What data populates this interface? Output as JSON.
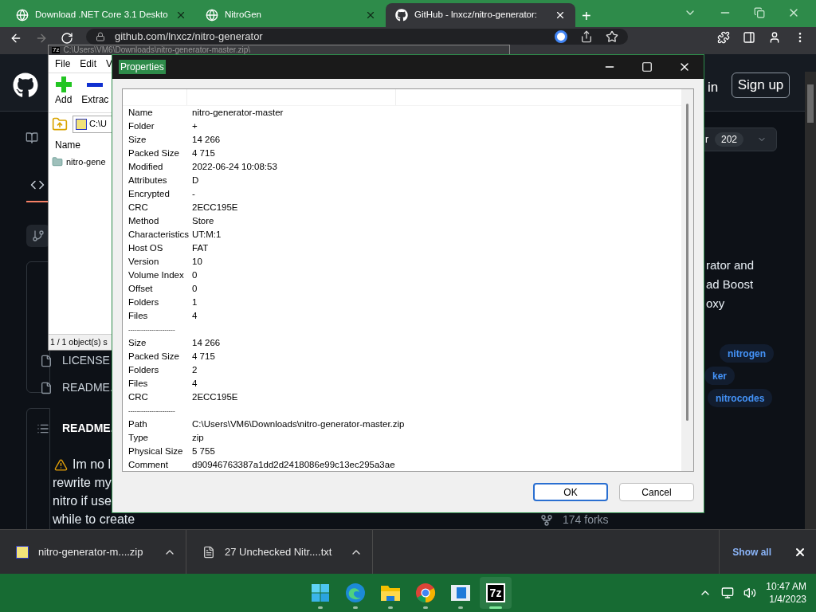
{
  "browser": {
    "tabs": [
      {
        "title": "Download .NET Core 3.1 Deskto",
        "selected": false
      },
      {
        "title": "NitroGen",
        "selected": false
      },
      {
        "title": "GitHub - lnxcz/nitro-generator:",
        "selected": true
      }
    ],
    "new_tab": "+",
    "address": "github.com/lnxcz/nitro-generator"
  },
  "github": {
    "sign_in": "in",
    "sign_up": "Sign up",
    "star_label": "r",
    "star_count": "202",
    "about_lines": [
      "rator and",
      "ad Boost",
      "oxy"
    ],
    "topics": [
      "nitrogen",
      "ker",
      "nitrocodes"
    ],
    "files": [
      "LICENSE",
      "README."
    ],
    "readme_title": "README.",
    "readme_lines": [
      "Im no l",
      "rewrite my",
      "nitro if use",
      "while to create"
    ],
    "forks": "174 forks"
  },
  "archive_window": {
    "icon_label": "7z",
    "title": "C:\\Users\\VM6\\Downloads\\nitro-generator-master.zip\\",
    "menu": [
      "File",
      "Edit",
      "V"
    ],
    "tools": [
      {
        "label": "Add",
        "kind": "add"
      },
      {
        "label": "Extrac",
        "kind": "extract"
      }
    ],
    "path": "C:\\U",
    "column": "Name",
    "items": [
      "nitro-gene"
    ],
    "status": "1 / 1 object(s) s"
  },
  "properties": {
    "title": "Properties",
    "rows": [
      {
        "kind": "pair",
        "name": "Name",
        "value": "nitro-generator-master"
      },
      {
        "kind": "pair",
        "name": "Folder",
        "value": "+"
      },
      {
        "kind": "pair",
        "name": "Size",
        "value": "14 266"
      },
      {
        "kind": "pair",
        "name": "Packed Size",
        "value": "4 715"
      },
      {
        "kind": "pair",
        "name": "Modified",
        "value": "2022-06-24 10:08:53"
      },
      {
        "kind": "pair",
        "name": "Attributes",
        "value": "D"
      },
      {
        "kind": "pair",
        "name": "Encrypted",
        "value": "-"
      },
      {
        "kind": "pair",
        "name": "CRC",
        "value": "2ECC195E"
      },
      {
        "kind": "pair",
        "name": "Method",
        "value": "Store"
      },
      {
        "kind": "pair",
        "name": "Characteristics",
        "value": "UT:M:1"
      },
      {
        "kind": "pair",
        "name": "Host OS",
        "value": "FAT"
      },
      {
        "kind": "pair",
        "name": "Version",
        "value": "10"
      },
      {
        "kind": "pair",
        "name": "Volume Index",
        "value": "0"
      },
      {
        "kind": "pair",
        "name": "Offset",
        "value": "0"
      },
      {
        "kind": "pair",
        "name": "Folders",
        "value": "1"
      },
      {
        "kind": "pair",
        "name": "Files",
        "value": "4"
      },
      {
        "kind": "separator",
        "name": "----------------------"
      },
      {
        "kind": "pair",
        "name": "Size",
        "value": "14 266"
      },
      {
        "kind": "pair",
        "name": "Packed Size",
        "value": "4 715"
      },
      {
        "kind": "pair",
        "name": "Folders",
        "value": "2"
      },
      {
        "kind": "pair",
        "name": "Files",
        "value": "4"
      },
      {
        "kind": "pair",
        "name": "CRC",
        "value": "2ECC195E"
      },
      {
        "kind": "separator",
        "name": "----------------------"
      },
      {
        "kind": "pair",
        "name": "Path",
        "value": "C:\\Users\\VM6\\Downloads\\nitro-generator-master.zip"
      },
      {
        "kind": "pair",
        "name": "Type",
        "value": "zip"
      },
      {
        "kind": "pair",
        "name": "Physical Size",
        "value": "5 755"
      },
      {
        "kind": "pair",
        "name": "Comment",
        "value": "d90946763387a1dd2d2418086e99c13ec295a3ae"
      }
    ],
    "buttons": [
      {
        "label": "OK",
        "default": true
      },
      {
        "label": "Cancel",
        "default": false
      }
    ]
  },
  "downloads": {
    "items": [
      {
        "name": "nitro-generator-m....zip",
        "kind": "archive"
      },
      {
        "name": "27 Unchecked Nitr....txt",
        "kind": "text"
      }
    ],
    "show_all": "Show all"
  },
  "taskbar": {
    "apps": [
      {
        "kind": "start",
        "active": false
      },
      {
        "kind": "edge",
        "active": false
      },
      {
        "kind": "explorer",
        "active": false
      },
      {
        "kind": "chrome",
        "active": false
      },
      {
        "kind": "viewer",
        "active": false
      },
      {
        "kind": "sevenzip",
        "active": true
      }
    ],
    "sevenzip_label": "7z",
    "time": "10:47 AM",
    "date": "1/4/2023"
  }
}
